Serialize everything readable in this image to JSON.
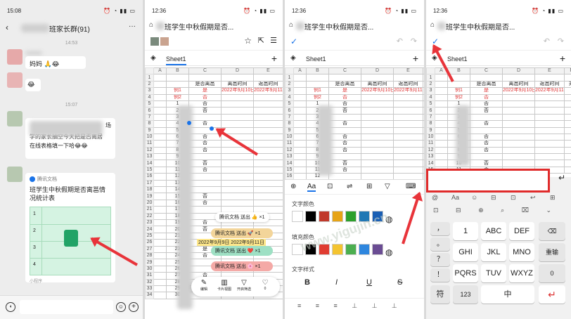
{
  "chat": {
    "time": "15:08",
    "title_prefix": "<",
    "title_suffix": "班家长群(91)",
    "more": "···",
    "stamp1": "14:53",
    "stamp2": "15:07",
    "bubble1": "妈妈 🙏😂",
    "bubble2": "😂",
    "msg_line1": "场",
    "msg_line2": "学的家长抽空今天把是否离居",
    "msg_line3": "在线表格填一下哈😂😂",
    "card_source": "腾讯文档",
    "card_title": "班学生中秋假期是否离邕情况统计表",
    "card_footer": "小程序",
    "grid_rows": [
      "1",
      "2",
      "3",
      "4"
    ],
    "input_hint": ""
  },
  "doc1": {
    "time": "12:36",
    "title": "班学生中秋假期是否...",
    "sheet": "Sheet1",
    "cols": [
      "A",
      "B",
      "C",
      "D",
      "E",
      "F"
    ],
    "header_labels": [
      "是否离邕",
      "离邕时间",
      "返邕时间",
      "乘"
    ],
    "ex1": [
      "例1",
      "是",
      "2022年9月10日",
      "2022年9月11日"
    ],
    "ex2": [
      "例2",
      "否"
    ],
    "nums": [
      "1",
      "2",
      "3",
      "4",
      "5",
      "6",
      "7",
      "8",
      "9",
      "10",
      "11",
      "12",
      "13",
      "14",
      "15",
      "16",
      "17",
      "18",
      "19",
      "20",
      "21",
      "22",
      "23",
      "24",
      "25",
      "26",
      "27",
      "28",
      "29",
      "30",
      "31",
      "32",
      "33",
      "34",
      "35"
    ],
    "c_vals": [
      "否",
      "否",
      "",
      "否",
      "",
      "否",
      "否",
      "否",
      "",
      "否",
      "否",
      "",
      "",
      "",
      "否",
      "否",
      "",
      "",
      "否",
      "否",
      "",
      "",
      "是",
      "否",
      "",
      "",
      "否",
      "",
      "",
      "",
      "否",
      "",
      "否",
      "",
      ""
    ],
    "toasts": [
      {
        "text": "腾讯文档 送出 👍 ×1"
      },
      {
        "text": "腾讯文档 送出 🚀 ×1"
      },
      {
        "text": "腾讯文档 送出 ❤️ ×1"
      },
      {
        "text": "腾讯文档 送出 🌸 ×1"
      }
    ],
    "yellow_row": "2022年9月9日 2022年9月11日",
    "toolbar": [
      "编辑",
      "卡片视图",
      "开启筛选",
      "0"
    ]
  },
  "doc2": {
    "time": "12:36",
    "title": "班学生中秋假期是否...",
    "sheet": "Sheet1",
    "font_color_label": "文字颜色",
    "fill_color_label": "填充颜色",
    "style_label": "文字样式",
    "font_colors": [
      "#ffffff",
      "#000000",
      "#c0392b",
      "#e6a417",
      "#2ca02c",
      "#1f77b4",
      "#1a5fb4"
    ],
    "fill_colors": [
      "#ffffff",
      "#000000",
      "#e03c31",
      "#f4c430",
      "#4caf50",
      "#2e86de",
      "#6a4c93"
    ],
    "styles": [
      "B",
      "I",
      "U",
      "S"
    ],
    "watermark": "www.yigujin.cn"
  },
  "doc3": {
    "time": "12:36",
    "title": "班学生中秋假期是否...",
    "sheet": "Sheet1",
    "keys_row1": [
      "1",
      "ABC",
      "DEF"
    ],
    "keys_row2": [
      "GHI",
      "JKL",
      "MNO"
    ],
    "keys_row3": [
      "PQRS",
      "TUV",
      "WXYZ"
    ],
    "keys_row1_sub": [
      "",
      "",
      ""
    ],
    "side_left": [
      "，",
      "。",
      "？",
      "！"
    ],
    "right_keys": [
      "⌫",
      "重输",
      "0"
    ],
    "bottom": [
      "符",
      "123",
      "中",
      "↵"
    ],
    "punct": [
      "，",
      "。",
      "？",
      "！"
    ],
    "nums_small": [
      "1",
      "2",
      "3"
    ],
    "suggest": [
      "@",
      "Aa",
      "☺",
      "⊟",
      "⊡",
      "↩",
      "⊞"
    ],
    "enter": "↵"
  },
  "colors": {
    "accent": "#1a73e8",
    "red": "#e8343a",
    "green": "#21a366"
  }
}
